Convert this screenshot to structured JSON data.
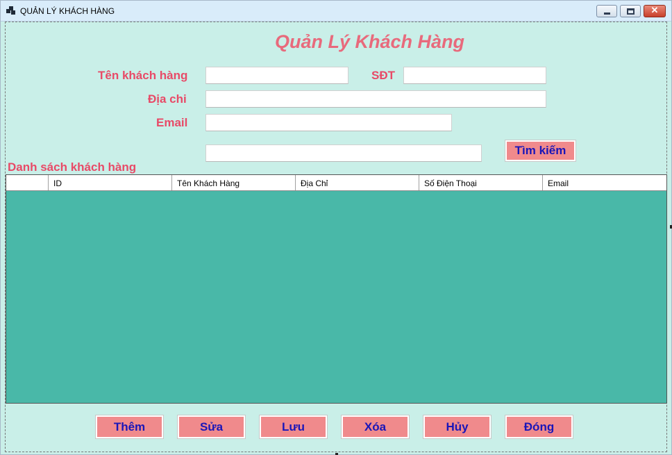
{
  "window": {
    "title": "QUẢN LÝ KHÁCH HÀNG",
    "controls": {
      "minimize": "–",
      "maximize": "□",
      "close": "✕"
    }
  },
  "form": {
    "heading": "Quản Lý Khách Hàng",
    "name_label": "Tên khách hàng",
    "name_value": "",
    "phone_label": "SĐT",
    "phone_value": "",
    "address_label": "Địa chi",
    "address_value": "",
    "email_label": "Email",
    "email_value": "",
    "search_value": "",
    "search_button": "Tìm kiếm"
  },
  "list": {
    "caption": "Danh sách khách hàng",
    "columns": [
      "",
      "ID",
      "Tên Khách Hàng",
      "Địa Chỉ",
      "Số Điện Thoại",
      "Email"
    ],
    "rows": []
  },
  "actions": {
    "add": "Thêm",
    "edit": "Sửa",
    "save": "Lưu",
    "delete": "Xóa",
    "cancel": "Hủy",
    "close": "Đóng"
  },
  "colors": {
    "background": "#c9efe8",
    "accent_text": "#e84a67",
    "button_fill": "#f08a8c",
    "button_text": "#1a16b8",
    "grid_background": "#49b8a8"
  }
}
